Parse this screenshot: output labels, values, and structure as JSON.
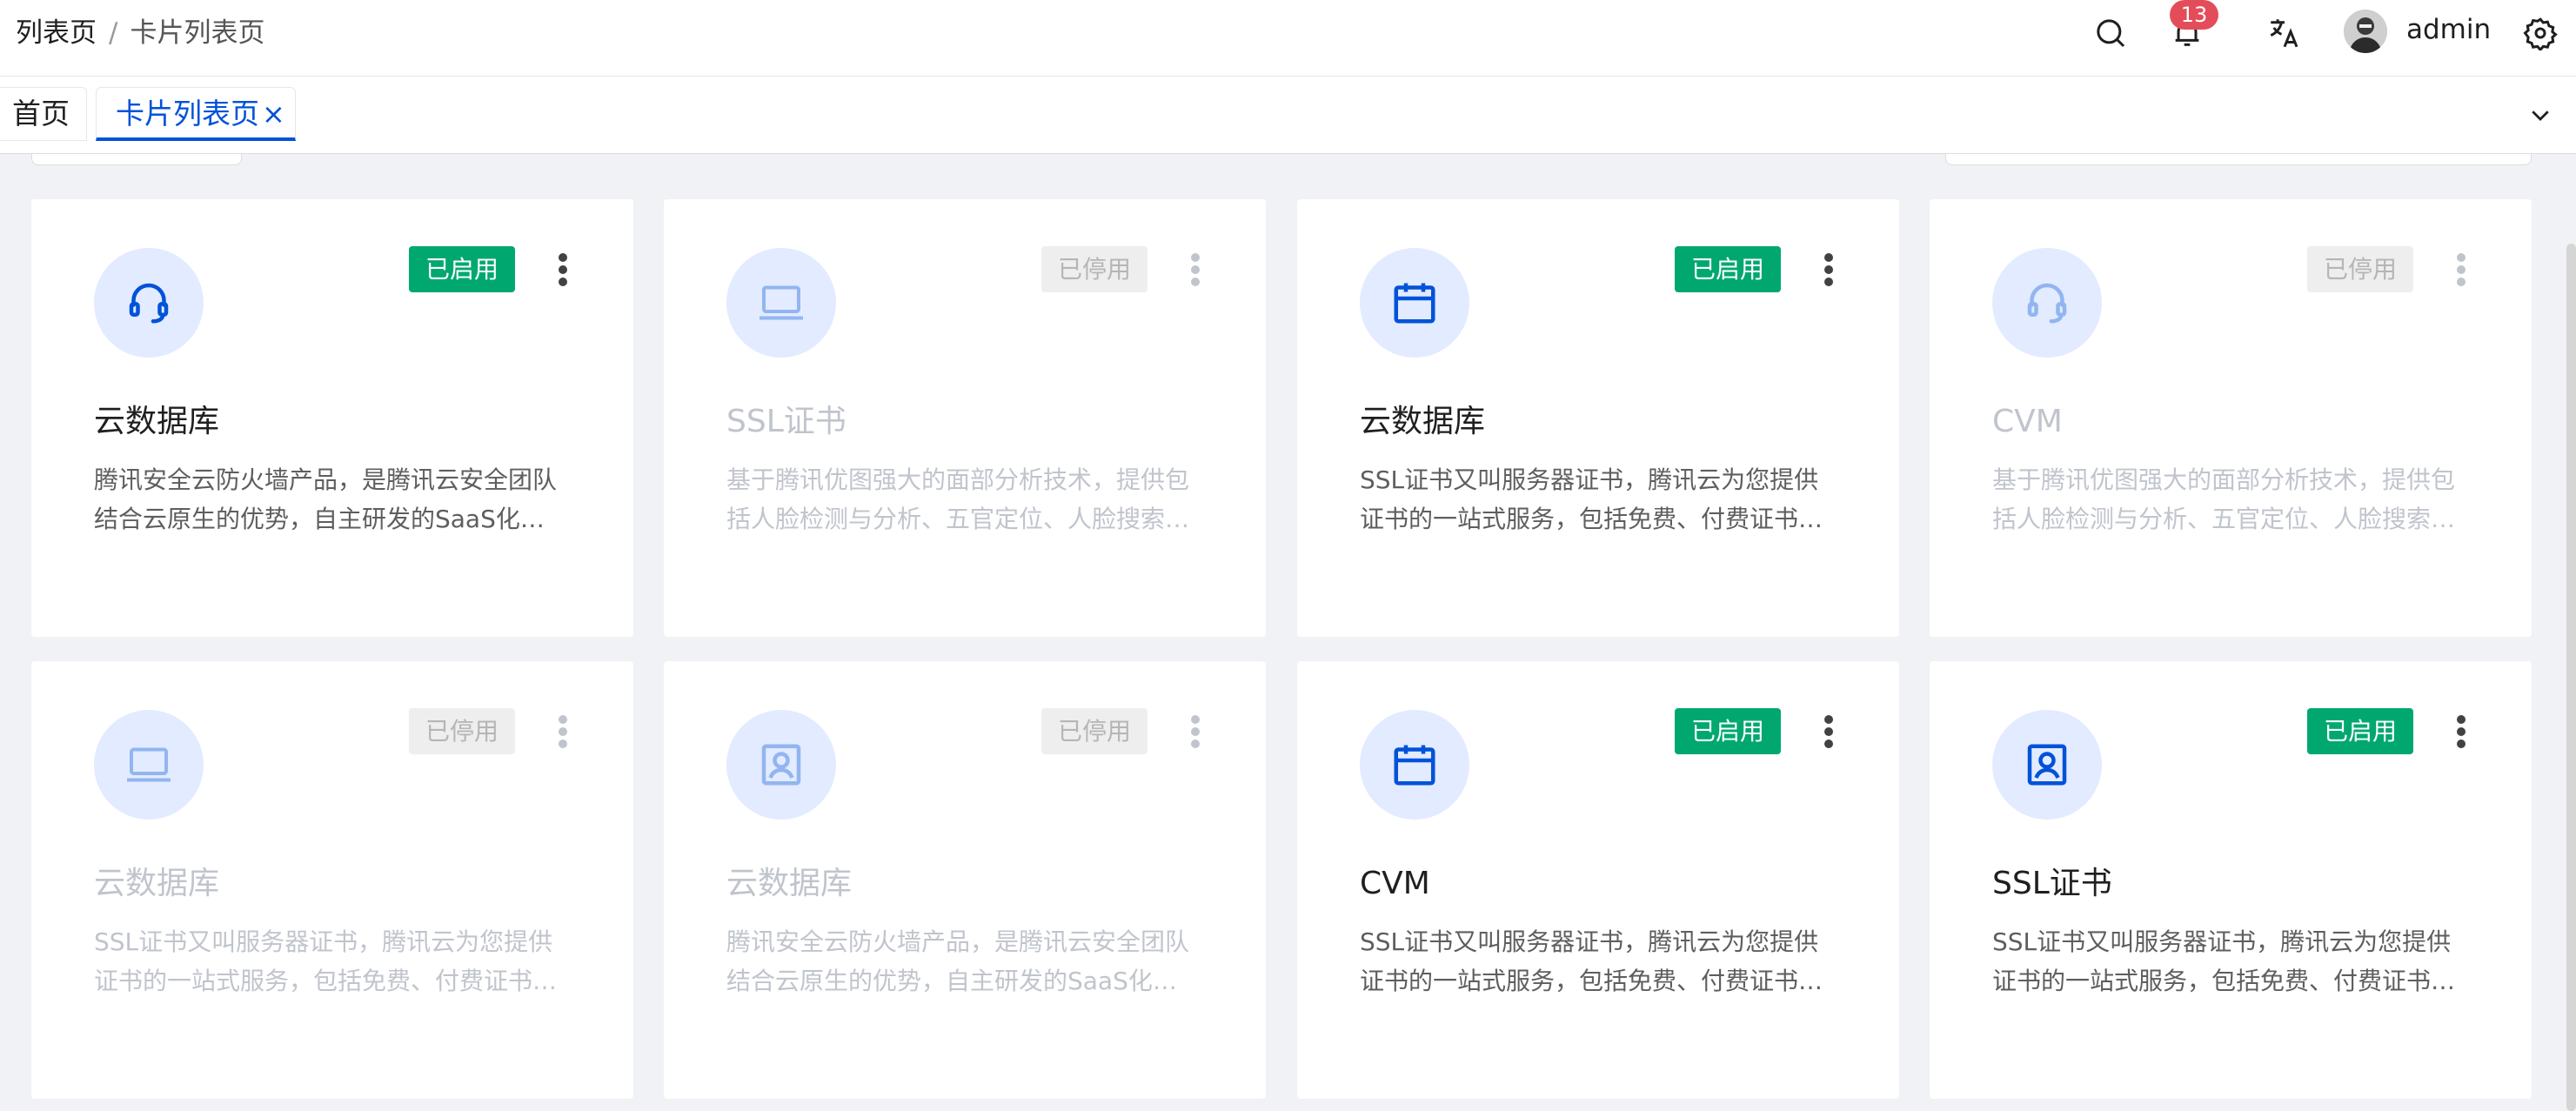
{
  "breadcrumb": {
    "items": [
      "列表页",
      "卡片列表页"
    ],
    "separator": "/"
  },
  "header": {
    "notification_count": "13",
    "username": "admin"
  },
  "tabs": {
    "home_label": "首页",
    "active_label": "卡片列表页",
    "close_glyph": "×"
  },
  "colors": {
    "brand": "#0052d9",
    "enabled": "#00a870",
    "badge": "#e34d59",
    "icon_bg": "#e2ebff"
  },
  "cards": [
    {
      "icon": "headset-icon",
      "status": "已启用",
      "enabled": true,
      "title": "云数据库",
      "desc": "腾讯安全云防火墙产品，是腾讯云安全团队结合云原生的优势，自主研发的SaaS化防火墙产品"
    },
    {
      "icon": "laptop-icon",
      "status": "已停用",
      "enabled": false,
      "title": "SSL证书",
      "desc": "基于腾讯优图强大的面部分析技术，提供包括人脸检测与分析、五官定位、人脸搜索、人脸比对等服务"
    },
    {
      "icon": "calendar-icon",
      "status": "已启用",
      "enabled": true,
      "title": "云数据库",
      "desc": "SSL证书又叫服务器证书，腾讯云为您提供证书的一站式服务，包括免费、付费证书的申请、管理及部署"
    },
    {
      "icon": "headset-icon",
      "status": "已停用",
      "enabled": false,
      "title": "CVM",
      "desc": "基于腾讯优图强大的面部分析技术，提供包括人脸检测与分析、五官定位、人脸搜索、人脸比对等服务"
    },
    {
      "icon": "laptop-icon",
      "status": "已停用",
      "enabled": false,
      "title": "云数据库",
      "desc": "SSL证书又叫服务器证书，腾讯云为您提供证书的一站式服务，包括免费、付费证书的申请、管理及部署"
    },
    {
      "icon": "user-card-icon",
      "status": "已停用",
      "enabled": false,
      "title": "云数据库",
      "desc": "腾讯安全云防火墙产品，是腾讯云安全团队结合云原生的优势，自主研发的SaaS化防火墙产品"
    },
    {
      "icon": "calendar-icon",
      "status": "已启用",
      "enabled": true,
      "title": "CVM",
      "desc": "SSL证书又叫服务器证书，腾讯云为您提供证书的一站式服务，包括免费、付费证书的申请、管理及部署"
    },
    {
      "icon": "user-card-icon",
      "status": "已启用",
      "enabled": true,
      "title": "SSL证书",
      "desc": "SSL证书又叫服务器证书，腾讯云为您提供证书的一站式服务，包括免费、付费证书的申请、管理及部署"
    }
  ]
}
